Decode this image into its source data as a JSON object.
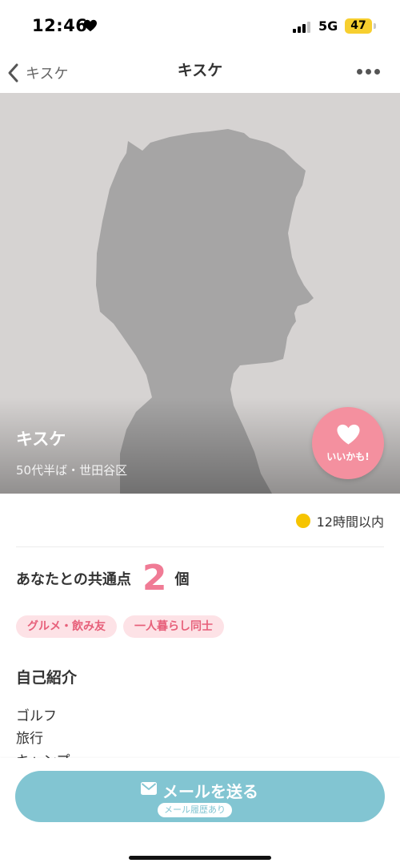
{
  "status_bar": {
    "time": "12:46",
    "network": "5G",
    "battery": "47"
  },
  "nav": {
    "back_label": "キスケ",
    "title": "キスケ"
  },
  "profile": {
    "name": "キスケ",
    "meta": "50代半ば・世田谷区",
    "like_label": "いいかも!"
  },
  "activity": {
    "text": "12時間以内",
    "dot_color": "#f6c400"
  },
  "common_points": {
    "label": "あなたとの共通点",
    "count": "2",
    "unit": "個",
    "tags": [
      "グルメ・飲み友",
      "一人暮らし同士"
    ]
  },
  "self_intro": {
    "title": "自己紹介",
    "lines": [
      "ゴルフ",
      "旅行",
      "キャンプ"
    ]
  },
  "bottom": {
    "mail_label": "メールを送る",
    "mail_history": "メール履歴あり"
  },
  "colors": {
    "accent_pink": "#f07b95",
    "like_button": "#f4909f",
    "mail_button": "#82c5d2",
    "tag_bg": "#fde2e6"
  }
}
